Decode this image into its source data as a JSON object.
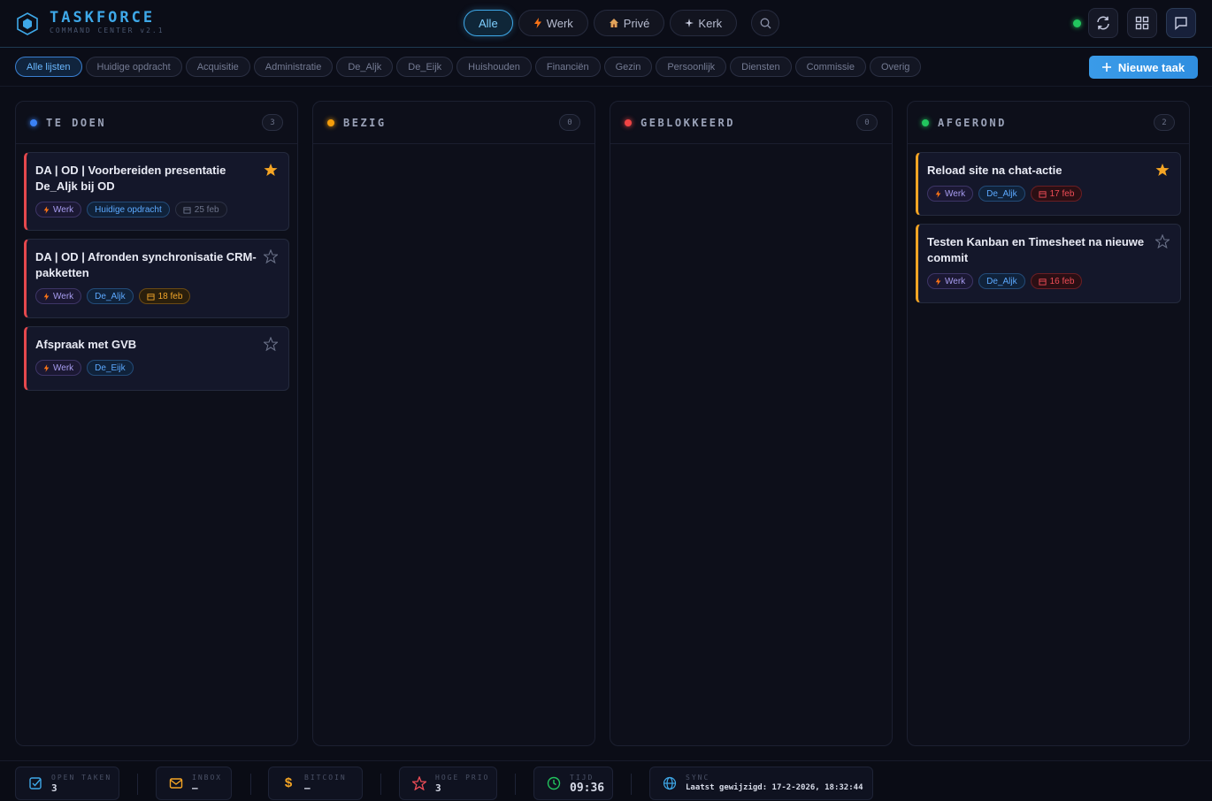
{
  "app": {
    "title": "TASKFORCE",
    "subtitle": "COMMAND CENTER v2.1"
  },
  "category_tabs": [
    {
      "label": "Alle",
      "icon": "",
      "active": true
    },
    {
      "label": "Werk",
      "icon": "lightning-icon",
      "active": false
    },
    {
      "label": "Privé",
      "icon": "house-icon",
      "active": false
    },
    {
      "label": "Kerk",
      "icon": "sparkle-icon",
      "active": false
    }
  ],
  "icons": {
    "search": "search-icon",
    "refresh": "refresh-icon",
    "grid": "grid-icon",
    "chat": "chat-icon"
  },
  "list_filters": [
    {
      "label": "Alle lijsten",
      "active": true
    },
    {
      "label": "Huidige opdracht",
      "active": false
    },
    {
      "label": "Acquisitie",
      "active": false
    },
    {
      "label": "Administratie",
      "active": false
    },
    {
      "label": "De_Aljk",
      "active": false
    },
    {
      "label": "De_Eijk",
      "active": false
    },
    {
      "label": "Huishouden",
      "active": false
    },
    {
      "label": "Financiën",
      "active": false
    },
    {
      "label": "Gezin",
      "active": false
    },
    {
      "label": "Persoonlijk",
      "active": false
    },
    {
      "label": "Diensten",
      "active": false
    },
    {
      "label": "Commissie",
      "active": false
    },
    {
      "label": "Overig",
      "active": false
    }
  ],
  "new_task_label": "Nieuwe taak",
  "colors": {
    "accent": "#3ea8e8",
    "todo": "#3b82f6",
    "busy": "#f59e0b",
    "blocked": "#ef4444",
    "done": "#22c55e",
    "star": "#f5a524"
  },
  "columns": [
    {
      "title": "TE DOEN",
      "count": "3",
      "color": "#3b82f6",
      "cards": [
        {
          "title": "DA | OD | Voorbereiden presentatie De_Aljk bij OD",
          "starred": true,
          "tags": [
            {
              "type": "work",
              "label": "Werk"
            },
            {
              "type": "list",
              "label": "Huidige opdracht"
            },
            {
              "type": "date",
              "label": "25 feb",
              "state": "normal"
            }
          ]
        },
        {
          "title": "DA | OD | Afronden synchronisatie CRM-pakketten",
          "starred": false,
          "tags": [
            {
              "type": "work",
              "label": "Werk"
            },
            {
              "type": "list",
              "label": "De_Aljk"
            },
            {
              "type": "date",
              "label": "18 feb",
              "state": "warn"
            }
          ]
        },
        {
          "title": "Afspraak met GVB",
          "starred": false,
          "tags": [
            {
              "type": "work",
              "label": "Werk"
            },
            {
              "type": "list",
              "label": "De_Eijk"
            }
          ]
        }
      ]
    },
    {
      "title": "BEZIG",
      "count": "0",
      "color": "#f59e0b",
      "cards": []
    },
    {
      "title": "GEBLOKKEERD",
      "count": "0",
      "color": "#ef4444",
      "cards": []
    },
    {
      "title": "AFGEROND",
      "count": "2",
      "color": "#22c55e",
      "cards": [
        {
          "title": "Reload site na chat-actie",
          "starred": true,
          "tags": [
            {
              "type": "work",
              "label": "Werk"
            },
            {
              "type": "list",
              "label": "De_Aljk"
            },
            {
              "type": "date",
              "label": "17 feb",
              "state": "over"
            }
          ]
        },
        {
          "title": "Testen Kanban en Timesheet na nieuwe commit",
          "starred": false,
          "tags": [
            {
              "type": "work",
              "label": "Werk"
            },
            {
              "type": "list",
              "label": "De_Aljk"
            },
            {
              "type": "date",
              "label": "16 feb",
              "state": "over"
            }
          ]
        }
      ]
    }
  ],
  "footer": {
    "open_tasks": {
      "label": "OPEN TAKEN",
      "value": "3",
      "icon": "checkbox-icon"
    },
    "inbox": {
      "label": "INBOX",
      "value": "–",
      "icon": "mail-icon"
    },
    "bitcoin": {
      "label": "BITCOIN",
      "value": "–",
      "icon": "dollar-icon"
    },
    "high_prio": {
      "label": "HOGE PRIO",
      "value": "3",
      "icon": "star-icon"
    },
    "time": {
      "label": "TIJD",
      "value": "09:36",
      "icon": "clock-icon"
    },
    "sync": {
      "label": "SYNC",
      "value": "Laatst gewijzigd: 17-2-2026, 18:32:44",
      "icon": "globe-icon"
    }
  }
}
